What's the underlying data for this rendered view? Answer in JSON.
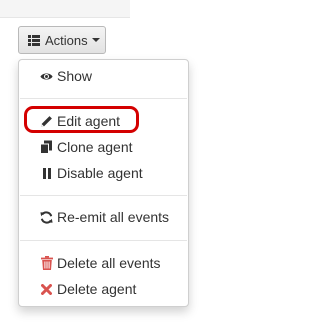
{
  "actions_button": {
    "label": "Actions",
    "icon": "list-icon"
  },
  "menu": {
    "items": [
      {
        "label": "Show",
        "icon": "eye-icon"
      },
      {
        "label": "Edit agent",
        "icon": "pencil-icon"
      },
      {
        "label": "Clone agent",
        "icon": "copy-icon"
      },
      {
        "label": "Disable agent",
        "icon": "pause-icon"
      },
      {
        "label": "Re-emit all events",
        "icon": "refresh-icon"
      },
      {
        "label": "Delete all events",
        "icon": "trash-icon"
      },
      {
        "label": "Delete agent",
        "icon": "times-icon"
      }
    ]
  },
  "colors": {
    "highlight": "#d40000",
    "danger": "#d9534f",
    "text": "#333333"
  }
}
